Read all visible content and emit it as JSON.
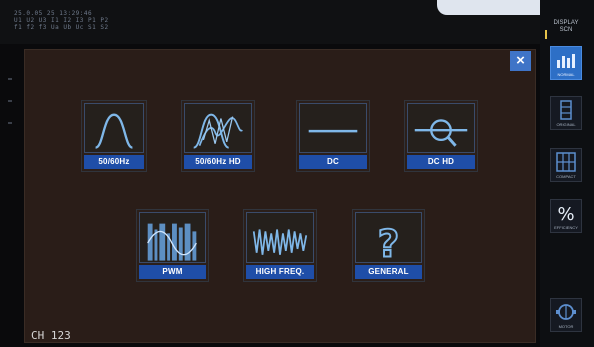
{
  "status": {
    "rows": [
      "25.0.05 25  13:29:46",
      "U1 U2 U3  I1 I2 I3  P1 P2",
      "f1 f2 f3  Ua Ub Uc  S1 S2"
    ]
  },
  "dialog": {
    "close_label": "×",
    "tiles": [
      {
        "label": "50/60Hz",
        "icon": "sine-wave-icon"
      },
      {
        "label": "50/60Hz HD",
        "icon": "harmonic-wave-icon"
      },
      {
        "label": "DC",
        "icon": "dc-line-icon"
      },
      {
        "label": "DC HD",
        "icon": "dc-magnify-icon"
      },
      {
        "label": "PWM",
        "icon": "pwm-signal-icon"
      },
      {
        "label": "HIGH FREQ.",
        "icon": "high-frequency-icon"
      },
      {
        "label": "GENERAL",
        "icon": "question-icon"
      }
    ]
  },
  "channel_label": "CH 123",
  "sidebar": {
    "header_lines": [
      "DISPLAY",
      "SCN"
    ],
    "buttons": [
      {
        "label": "NORMAL",
        "icon": "normal-mode-icon",
        "active": true
      },
      {
        "label": "ORIGINAL",
        "icon": "original-mode-icon",
        "active": false
      },
      {
        "label": "COMPACT",
        "icon": "compact-mode-icon",
        "active": false
      },
      {
        "label": "EFFICIENCY",
        "icon": "percent-icon",
        "active": false
      },
      {
        "label": "MOTOR",
        "icon": "motor-icon",
        "active": false
      }
    ]
  },
  "colors": {
    "dialog_bg": "#2a1d18",
    "label_bg": "#1f4ea8",
    "waveform": "#7fb7e8",
    "accent": "#3f74c7"
  }
}
